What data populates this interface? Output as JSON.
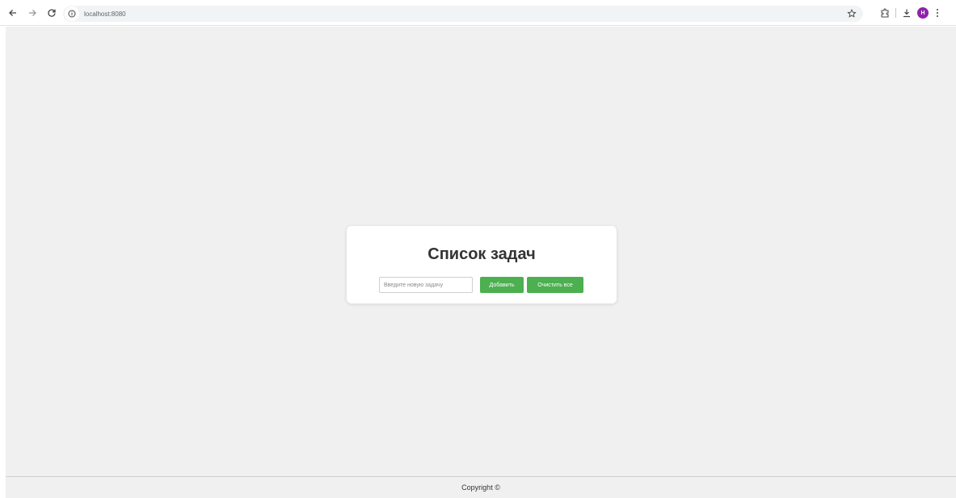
{
  "browser": {
    "url": "localhost:8080",
    "avatar_letter": "Н"
  },
  "page": {
    "title": "Список задач",
    "input_placeholder": "Введите новую задачу",
    "add_button": "Добавить",
    "clear_button": "Очистить все",
    "footer": "Copyright ©"
  },
  "colors": {
    "accent": "#4caf50",
    "page_bg": "#f0f0f0",
    "avatar": "#8e24aa"
  }
}
